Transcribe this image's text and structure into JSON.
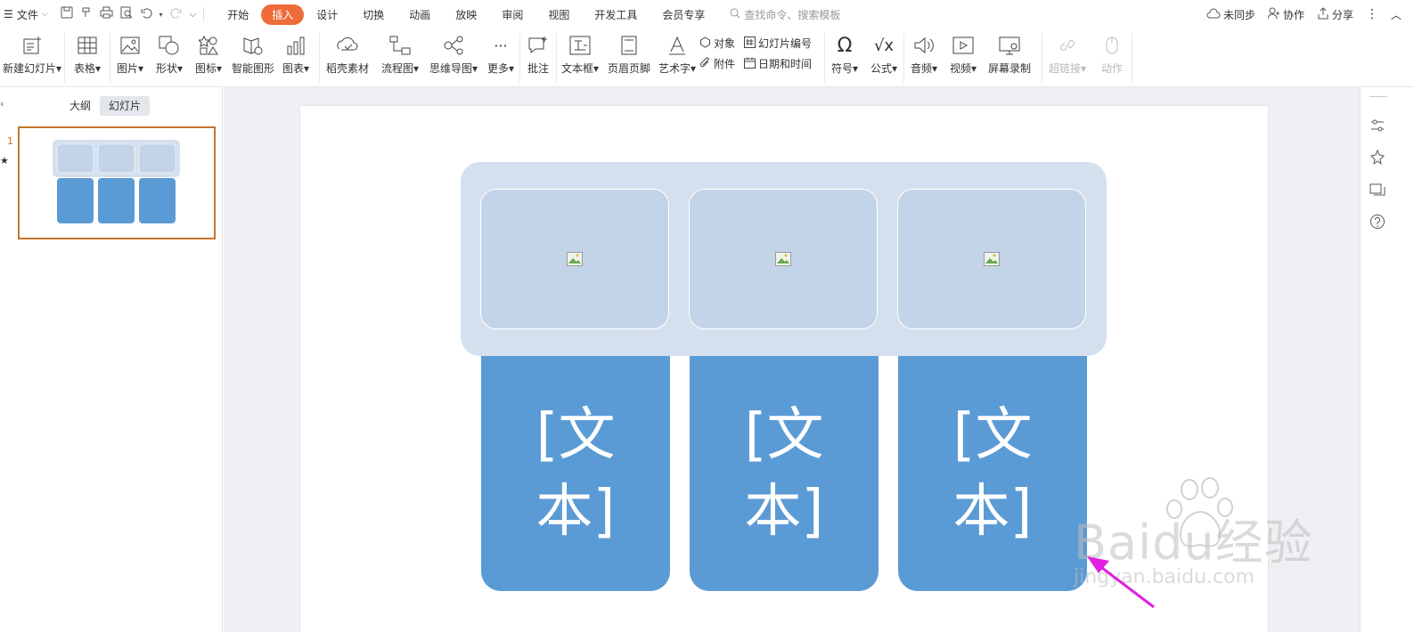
{
  "menubar": {
    "file_label": "文件",
    "tabs": [
      {
        "label": "开始",
        "active": false
      },
      {
        "label": "插入",
        "active": true
      },
      {
        "label": "设计",
        "active": false
      },
      {
        "label": "切换",
        "active": false
      },
      {
        "label": "动画",
        "active": false
      },
      {
        "label": "放映",
        "active": false
      },
      {
        "label": "审阅",
        "active": false
      },
      {
        "label": "视图",
        "active": false
      },
      {
        "label": "开发工具",
        "active": false
      },
      {
        "label": "会员专享",
        "active": false
      }
    ],
    "search_placeholder": "查找命令、搜索模板",
    "sync_label": "未同步",
    "collab_label": "协作",
    "share_label": "分享"
  },
  "ribbon": {
    "new_slide": "新建幻灯片",
    "table": "表格",
    "picture": "图片",
    "shape": "形状",
    "icon": "图标",
    "smart_art": "智能图形",
    "chart": "图表",
    "docer_assets": "稻壳素材",
    "flowchart": "流程图",
    "mindmap": "思维导图",
    "more": "更多",
    "comment": "批注",
    "textbox": "文本框",
    "header_footer": "页眉页脚",
    "wordart": "艺术字",
    "object": "对象",
    "attachment": "附件",
    "slide_number": "幻灯片编号",
    "date_time": "日期和时间",
    "symbol": "符号",
    "equation": "公式",
    "audio": "音频",
    "video": "视频",
    "screen_record": "屏幕录制",
    "hyperlink": "超链接",
    "action": "动作"
  },
  "left_panel": {
    "tab_outline": "大纲",
    "tab_slides": "幻灯片",
    "slide_number": "1"
  },
  "slide": {
    "cards": [
      {
        "text": "[文本]"
      },
      {
        "text": "[文本]"
      },
      {
        "text": "[文本]"
      }
    ]
  },
  "watermark": {
    "brand": "Baidu经验",
    "url": "jingyan.baidu.com"
  },
  "colors": {
    "accent": "#ee6b3a",
    "card_blue": "#5b9bd5",
    "band": "#d5e0ef",
    "placeholder": "#c3d4e8",
    "thumb_border": "#c5742e",
    "arrow": "#e020e0"
  }
}
